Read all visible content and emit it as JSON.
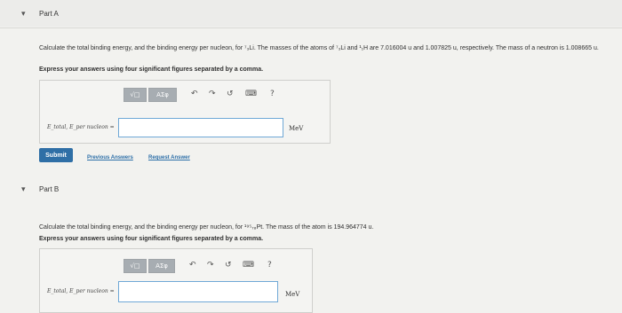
{
  "partA": {
    "chevron": "▾",
    "title": "Part A",
    "question": "Calculate the total binding energy, and the binding energy per nucleon, for ⁷₃Li. The masses of the atoms of ⁷₃Li and ¹₁H are 7.016004 u and 1.007825 u, respectively. The mass of a neutron is 1.008665 u.",
    "instructions": "Express your answers using four significant figures separated by a comma.",
    "toolbar": [
      "√□",
      "ΑΣφ",
      "↶",
      "↷",
      "↺",
      "⌨",
      "?"
    ],
    "eq_label": "E_total, E_per nucleon =",
    "unit": "MeV",
    "submit_label": "Submit",
    "previous_answers": "Previous Answers",
    "request_answer": "Request Answer"
  },
  "partB": {
    "chevron": "▾",
    "title": "Part B",
    "question": "Calculate the total binding energy, and the binding energy per nucleon, for ¹⁹⁵₇₈Pt. The mass of the atom is 194.964774 u.",
    "instructions": "Express your answers using four significant figures separated by a comma.",
    "toolbar": [
      "√□",
      "ΑΣφ",
      "↶",
      "↷",
      "↺",
      "⌨",
      "?"
    ],
    "eq_label": "E_total, E_per nucleon =",
    "unit": "MeV"
  }
}
